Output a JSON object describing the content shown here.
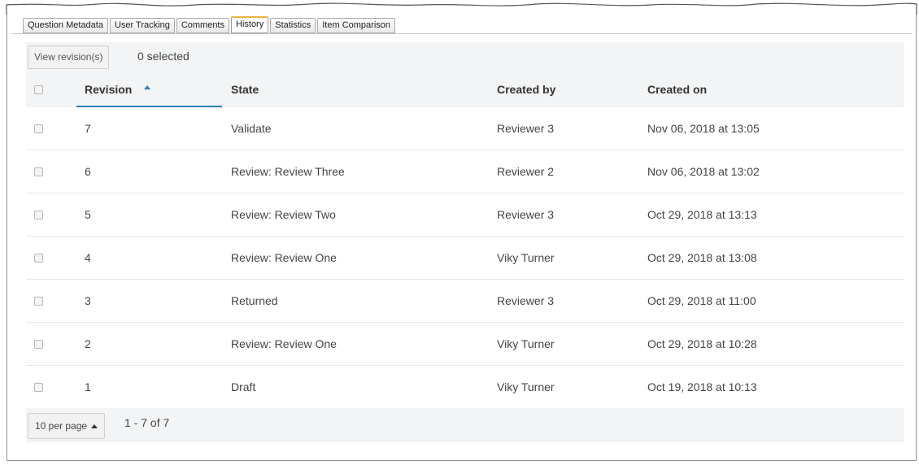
{
  "tabs": [
    {
      "label": "Question Metadata",
      "active": false
    },
    {
      "label": "User Tracking",
      "active": false
    },
    {
      "label": "Comments",
      "active": false
    },
    {
      "label": "History",
      "active": true
    },
    {
      "label": "Statistics",
      "active": false
    },
    {
      "label": "Item Comparison",
      "active": false
    }
  ],
  "toolbar": {
    "view_button_label": "View revision(s)",
    "selected_text": "0 selected"
  },
  "table": {
    "headers": {
      "revision": "Revision",
      "state": "State",
      "created_by": "Created by",
      "created_on": "Created on"
    },
    "sort": {
      "column": "revision",
      "direction": "ascending",
      "accent_color": "#2a7fae"
    },
    "rows": [
      {
        "revision": "7",
        "state": "Validate",
        "created_by": "Reviewer 3",
        "created_on": "Nov 06, 2018 at 13:05"
      },
      {
        "revision": "6",
        "state": "Review: Review Three",
        "created_by": "Reviewer 2",
        "created_on": "Nov 06, 2018 at 13:02"
      },
      {
        "revision": "5",
        "state": "Review: Review Two",
        "created_by": "Reviewer 3",
        "created_on": "Oct 29, 2018 at 13:13"
      },
      {
        "revision": "4",
        "state": "Review: Review One",
        "created_by": "Viky Turner",
        "created_on": "Oct 29, 2018 at 13:08"
      },
      {
        "revision": "3",
        "state": "Returned",
        "created_by": "Reviewer 3",
        "created_on": "Oct 29, 2018 at 11:00"
      },
      {
        "revision": "2",
        "state": "Review: Review One",
        "created_by": "Viky Turner",
        "created_on": "Oct 29, 2018 at 10:28"
      },
      {
        "revision": "1",
        "state": "Draft",
        "created_by": "Viky Turner",
        "created_on": "Oct 19, 2018 at 10:13"
      }
    ]
  },
  "footer": {
    "per_page_label": "10 per page",
    "range_text": "1 - 7 of 7"
  },
  "colors": {
    "active_tab_accent": "#f0b342",
    "toolbar_bg": "#f3f4f5"
  }
}
